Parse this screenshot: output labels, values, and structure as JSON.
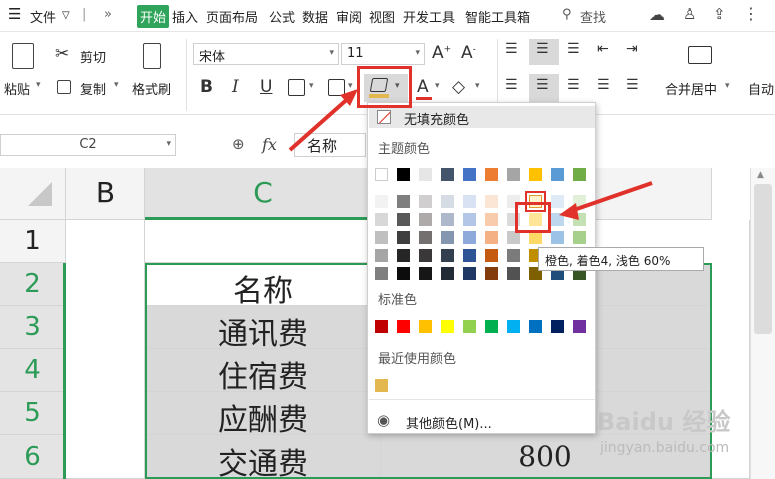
{
  "menubar": {
    "hamburger_icon": "menu-icon",
    "file": "文件",
    "more": "»",
    "tabs": [
      "开始",
      "插入",
      "页面布局",
      "公式",
      "数据",
      "审阅",
      "视图",
      "开发工具",
      "智能工具箱"
    ],
    "search": "查找"
  },
  "ribbon": {
    "paste": "粘贴",
    "cut": "剪切",
    "copy": "复制",
    "format_painter": "格式刷",
    "font_name": "宋体",
    "font_size": "11",
    "merge_center": "合并居中",
    "auto": "自动",
    "bold": "B",
    "italic": "I",
    "underline": "U"
  },
  "formula_bar": {
    "name_box": "C2",
    "fx": "fx",
    "content": "名称"
  },
  "grid": {
    "columns": [
      "B",
      "C"
    ],
    "rows": [
      "1",
      "2",
      "3",
      "4",
      "5",
      "6"
    ],
    "c_values": [
      "名称",
      "通讯费",
      "住宿费",
      "应酬费",
      "交通费"
    ],
    "d6_value": "800"
  },
  "color_popup": {
    "no_fill": "无填充颜色",
    "theme_colors_title": "主题颜色",
    "standard_title": "标准色",
    "recent_title": "最近使用颜色",
    "more_colors": "其他颜色(M)...",
    "theme_top": [
      "#ffffff",
      "#000000",
      "#e7e6e6",
      "#44546a",
      "#4472c4",
      "#ed7d31",
      "#a5a5a5",
      "#ffc000",
      "#5b9bd5",
      "#70ad47"
    ],
    "theme_shades": [
      [
        "#f2f2f2",
        "#7f7f7f",
        "#d0cece",
        "#d6dce4",
        "#d9e2f3",
        "#fbe5d5",
        "#ededed",
        "#fff2cc",
        "#deebf6",
        "#e2efd9"
      ],
      [
        "#d8d8d8",
        "#595959",
        "#aeaaaa",
        "#adb9ca",
        "#b4c6e7",
        "#f7cbac",
        "#dbdbdb",
        "#ffe598",
        "#bdd7ee",
        "#c5e0b3"
      ],
      [
        "#bfbfbf",
        "#3f3f3f",
        "#757070",
        "#8496b0",
        "#8eaadb",
        "#f4b183",
        "#c9c9c9",
        "#ffd966",
        "#9cc3e5",
        "#a8d08d"
      ],
      [
        "#a5a5a5",
        "#262626",
        "#3a3838",
        "#323f4f",
        "#2f5496",
        "#c55a11",
        "#7b7b7b",
        "#bf8f00",
        "#2e75b5",
        "#538135"
      ],
      [
        "#7f7f7f",
        "#0c0c0c",
        "#171616",
        "#222a35",
        "#1f3864",
        "#833c0b",
        "#525252",
        "#7f6000",
        "#1e4e79",
        "#375623"
      ]
    ],
    "standard": [
      "#c00000",
      "#ff0000",
      "#ffc000",
      "#ffff00",
      "#92d050",
      "#00b050",
      "#00b0f0",
      "#0070c0",
      "#002060",
      "#7030a0"
    ],
    "recent": [
      "#e2b84f"
    ],
    "tooltip": "橙色, 着色4, 浅色 60%"
  },
  "watermark": {
    "brand": "Baidu 经验",
    "url": "jingyan.baidu.com"
  }
}
